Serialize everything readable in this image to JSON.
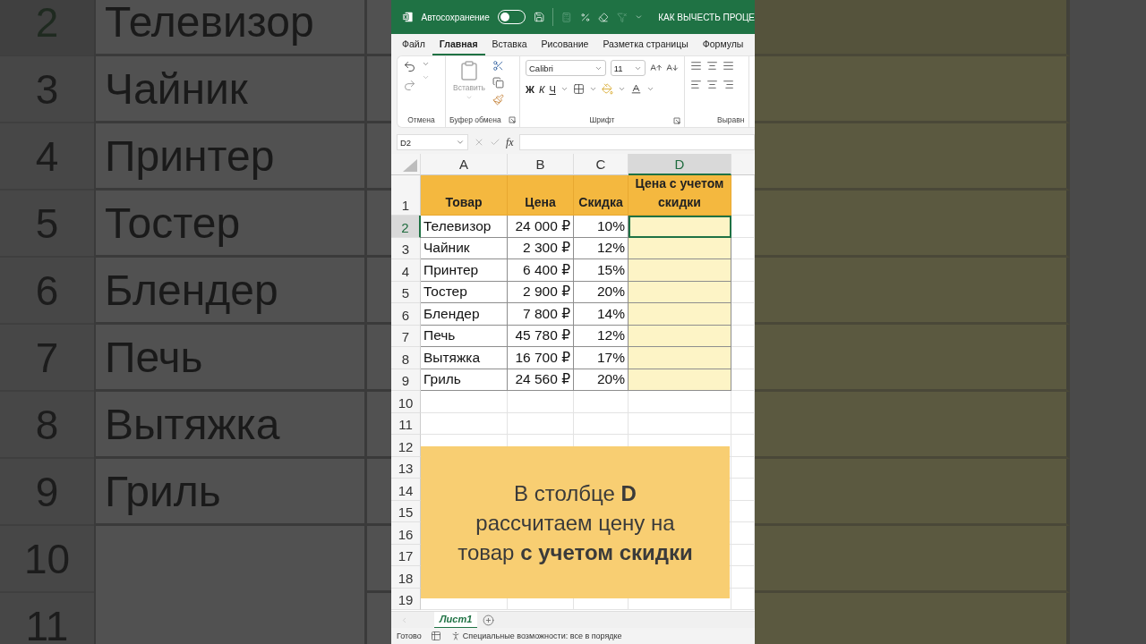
{
  "backdrop_left": {
    "rows": [
      {
        "number": "2",
        "item": "Телевизор",
        "selected": true
      },
      {
        "number": "3",
        "item": "Чайник",
        "selected": false
      },
      {
        "number": "4",
        "item": "Принтер",
        "selected": false
      },
      {
        "number": "5",
        "item": "Тостер",
        "selected": false
      },
      {
        "number": "6",
        "item": "Блендер",
        "selected": false
      },
      {
        "number": "7",
        "item": "Печь",
        "selected": false
      },
      {
        "number": "8",
        "item": "Вытяжка",
        "selected": false
      },
      {
        "number": "9",
        "item": "Гриль",
        "selected": false
      },
      {
        "number": "10",
        "selected": false
      },
      {
        "number": "11",
        "selected": false
      }
    ]
  },
  "title_bar": {
    "autosave_label": "Автосохранение",
    "autosave_on": false,
    "document_title": "КАК ВЫЧЕСТЬ ПРОЦЕ"
  },
  "ribbon_tabs": [
    {
      "label": "Файл",
      "selected": false
    },
    {
      "label": "Главная",
      "selected": true
    },
    {
      "label": "Вставка",
      "selected": false
    },
    {
      "label": "Рисование",
      "selected": false
    },
    {
      "label": "Разметка страницы",
      "selected": false
    },
    {
      "label": "Формулы",
      "selected": false
    }
  ],
  "ribbon": {
    "groups": [
      "Отмена",
      "Буфер обмена",
      "Шрифт",
      "Выравн"
    ],
    "paste_label": "Вставить",
    "font_name": "Calibri",
    "font_size": "11",
    "bold_key": "Ж",
    "italic_key": "К",
    "underline_key": "Ч"
  },
  "formula_bar": {
    "name_box": "D2",
    "function_label": "fx"
  },
  "sheet": {
    "columns": [
      {
        "label": "A",
        "selected": false
      },
      {
        "label": "B",
        "selected": false
      },
      {
        "label": "C",
        "selected": false
      },
      {
        "label": "D",
        "selected": true
      }
    ],
    "header_row": {
      "number": "1",
      "cells": [
        "Товар",
        "Цена",
        "Скидка",
        "Цена с учетом скидки"
      ]
    },
    "rows": [
      {
        "number": "2",
        "selected": true,
        "cells": [
          "Телевизор",
          "24 000 ₽",
          "10%"
        ]
      },
      {
        "number": "3",
        "selected": false,
        "cells": [
          "Чайник",
          "2 300 ₽",
          "12%"
        ]
      },
      {
        "number": "4",
        "selected": false,
        "cells": [
          "Принтер",
          "6 400 ₽",
          "15%"
        ]
      },
      {
        "number": "5",
        "selected": false,
        "cells": [
          "Тостер",
          "2 900 ₽",
          "20%"
        ]
      },
      {
        "number": "6",
        "selected": false,
        "cells": [
          "Блендер",
          "7 800 ₽",
          "14%"
        ]
      },
      {
        "number": "7",
        "selected": false,
        "cells": [
          "Печь",
          "45 780 ₽",
          "12%"
        ]
      },
      {
        "number": "8",
        "selected": false,
        "cells": [
          "Вытяжка",
          "16 700 ₽",
          "17%"
        ]
      },
      {
        "number": "9",
        "selected": false,
        "cells": [
          "Гриль",
          "24 560 ₽",
          "20%"
        ]
      }
    ],
    "empty_rows": [
      "10",
      "11",
      "12",
      "13",
      "14",
      "15",
      "16",
      "17",
      "18",
      "19"
    ]
  },
  "callout": {
    "lines": [
      "В столбце **D**",
      "рассчитаем цену на",
      "товар **с учетом скидки**"
    ]
  },
  "sheet_tabs": [
    {
      "label": "Лист1",
      "selected": true
    }
  ],
  "status_bar": {
    "ready": "Готово",
    "accessibility": "Специальные возможности: все в порядке"
  }
}
